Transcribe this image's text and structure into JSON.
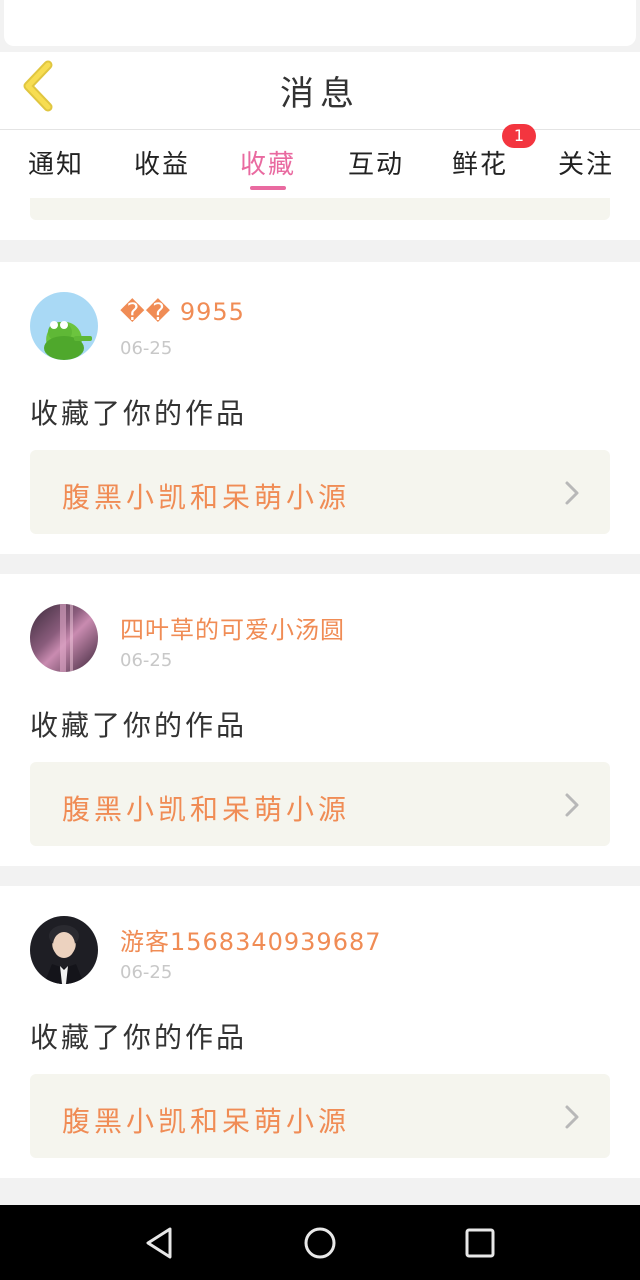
{
  "header": {
    "title": "消息",
    "back_icon": "chevron-left-icon"
  },
  "tabs": [
    {
      "label": "通知",
      "active": false
    },
    {
      "label": "收益",
      "active": false
    },
    {
      "label": "收藏",
      "active": true
    },
    {
      "label": "互动",
      "active": false
    },
    {
      "label": "鲜花",
      "active": false,
      "badge": "1"
    },
    {
      "label": "关注",
      "active": false
    }
  ],
  "colors": {
    "accent": "#e96aa0",
    "name": "#f08c55",
    "badge": "#f3353f"
  },
  "items": [
    {
      "username": "�� 9955",
      "date": "06-25",
      "action": "收藏了你的作品",
      "work_title": "腹黑小凯和呆萌小源",
      "avatar": "kermit-avatar"
    },
    {
      "username": "四叶草的可爱小汤圆",
      "date": "06-25",
      "action": "收藏了你的作品",
      "work_title": "腹黑小凯和呆萌小源",
      "avatar": "purple-avatar"
    },
    {
      "username": "游客1568340939687",
      "date": "06-25",
      "action": "收藏了你的作品",
      "work_title": "腹黑小凯和呆萌小源",
      "avatar": "boy-avatar"
    }
  ],
  "navbar": {
    "icons": [
      "back-triangle-icon",
      "home-circle-icon",
      "recents-square-icon"
    ]
  }
}
